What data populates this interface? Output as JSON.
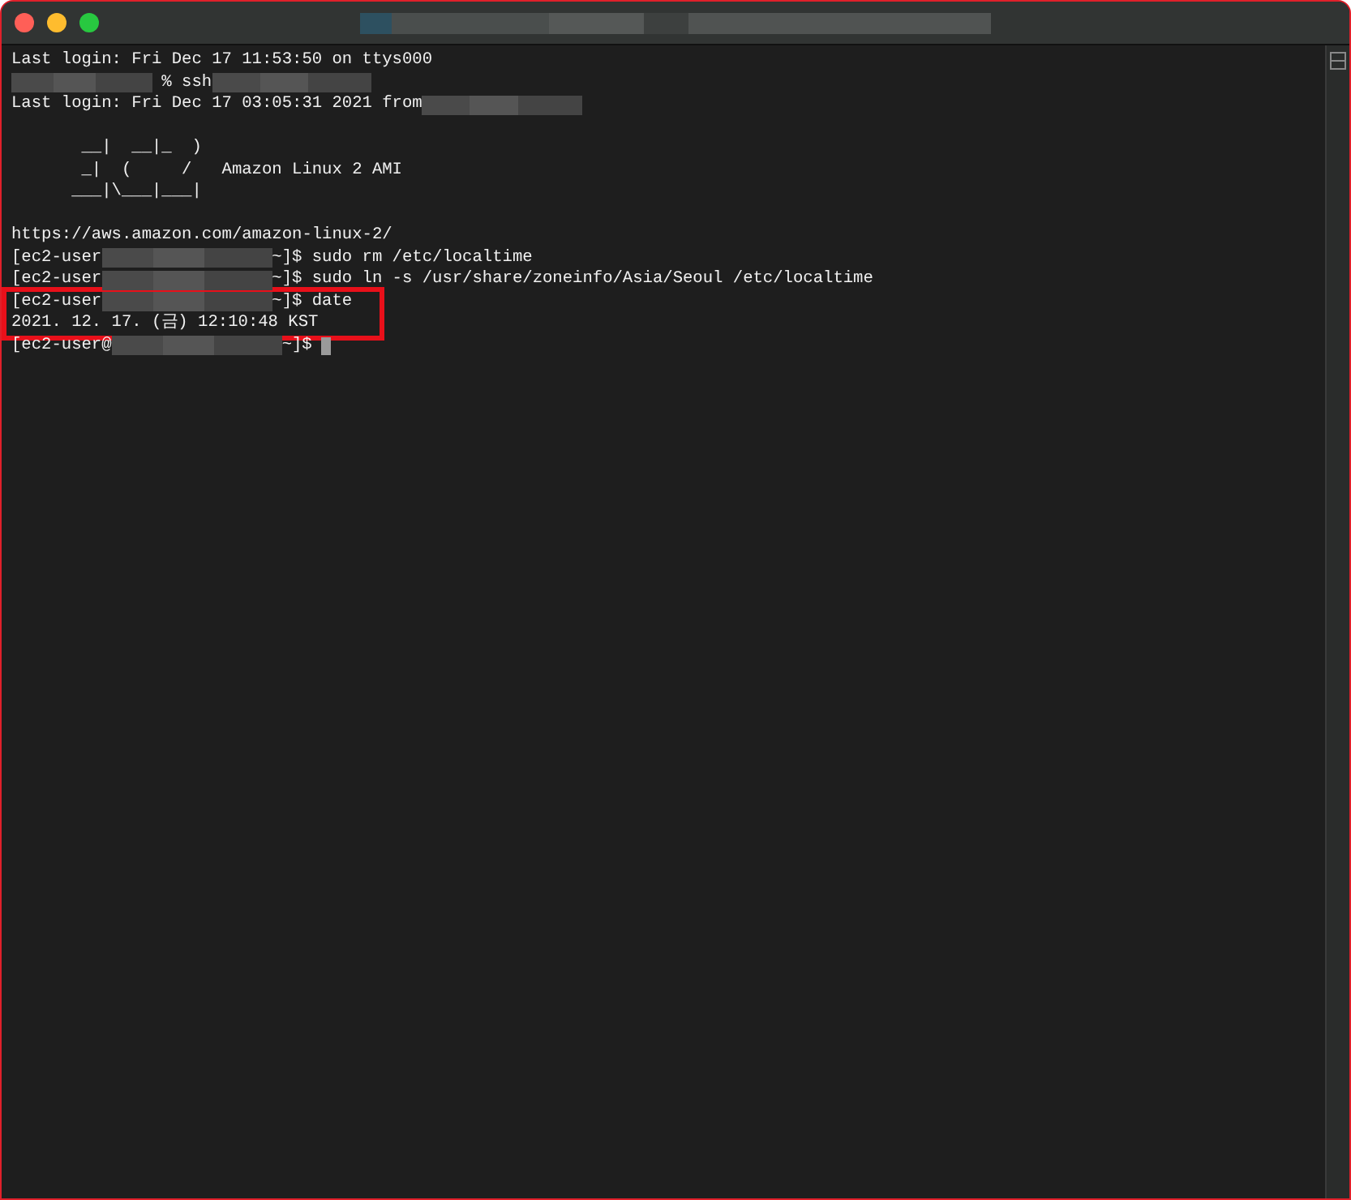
{
  "window": {
    "title_redacted": true
  },
  "terminal": {
    "groups": [
      {
        "highlighted": false,
        "lines": [
          {
            "kind": "text",
            "segments": [
              {
                "kind": "text",
                "text": "Last login: Fri Dec 17 11:53:50 on ttys000"
              }
            ]
          },
          {
            "kind": "text",
            "segments": [
              {
                "kind": "redacted"
              },
              {
                "kind": "text",
                "text": " % ssh"
              },
              {
                "kind": "redacted"
              }
            ]
          },
          {
            "kind": "text",
            "segments": [
              {
                "kind": "text",
                "text": "Last login: Fri Dec 17 03:05:31 2021 from"
              },
              {
                "kind": "redacted"
              }
            ]
          },
          {
            "kind": "blank"
          },
          {
            "kind": "text",
            "segments": [
              {
                "kind": "text",
                "text": "       __|  __|_  )"
              }
            ]
          },
          {
            "kind": "text",
            "segments": [
              {
                "kind": "text",
                "text": "       _|  (     /   Amazon Linux 2 AMI"
              }
            ]
          },
          {
            "kind": "text",
            "segments": [
              {
                "kind": "text",
                "text": "      ___|\\___|___|"
              }
            ]
          },
          {
            "kind": "blank"
          },
          {
            "kind": "text",
            "segments": [
              {
                "kind": "text",
                "text": "https://aws.amazon.com/amazon-linux-2/"
              }
            ]
          },
          {
            "kind": "text",
            "segments": [
              {
                "kind": "text",
                "text": "[ec2-user"
              },
              {
                "kind": "redacted"
              },
              {
                "kind": "text",
                "text": "~]$ sudo rm /etc/localtime"
              }
            ]
          },
          {
            "kind": "text",
            "segments": [
              {
                "kind": "text",
                "text": "[ec2-user"
              },
              {
                "kind": "redacted"
              },
              {
                "kind": "text",
                "text": "~]$ sudo ln -s /usr/share/zoneinfo/Asia/Seoul /etc/localtime"
              }
            ]
          }
        ]
      },
      {
        "highlighted": true,
        "lines": [
          {
            "kind": "text",
            "segments": [
              {
                "kind": "text",
                "text": "[ec2-user"
              },
              {
                "kind": "redacted"
              },
              {
                "kind": "text",
                "text": "~]$ date"
              }
            ]
          },
          {
            "kind": "text",
            "segments": [
              {
                "kind": "text",
                "text": "2021. 12. 17. (금) 12:10:48 KST"
              }
            ]
          }
        ]
      },
      {
        "highlighted": false,
        "lines": [
          {
            "kind": "prompt",
            "segments": [
              {
                "kind": "text",
                "text": "[ec2-user@"
              },
              {
                "kind": "redacted"
              },
              {
                "kind": "text",
                "text": "~]$"
              }
            ]
          }
        ]
      }
    ]
  }
}
